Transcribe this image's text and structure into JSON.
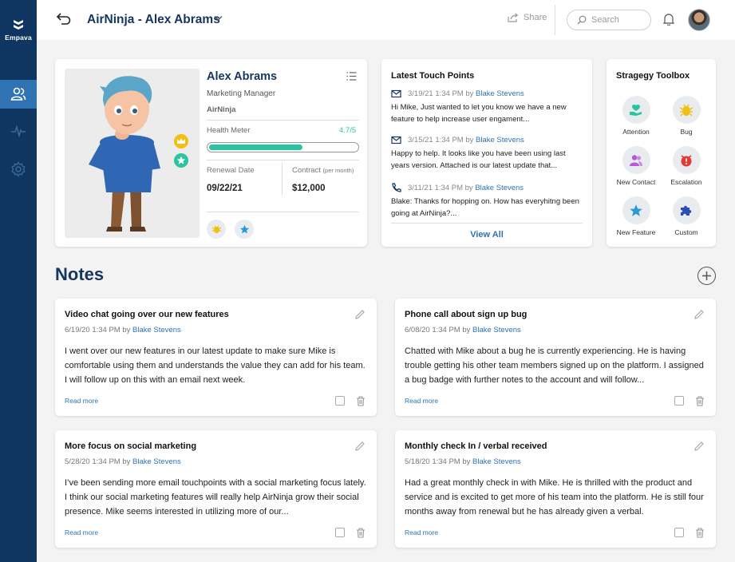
{
  "app": {
    "logo_text": "Empava"
  },
  "header": {
    "title": "AirNinja - Alex Abrams",
    "share_label": "Share",
    "search_placeholder": "Search"
  },
  "profile": {
    "name": "Alex Abrams",
    "title": "Marketing Manager",
    "company": "AirNinja",
    "health_label": "Health Meter",
    "health_value": "4.7/5",
    "health_fraction": 0.63,
    "renewal_label": "Renewal Date",
    "renewal_value": "09/22/21",
    "contract_label": "Contract",
    "contract_sub": "(per month)",
    "contract_value": "$12,000"
  },
  "touch_points": {
    "title": "Latest Touch Points",
    "items": [
      {
        "icon": "mail-icon",
        "date": "3/19/21 1:34 PM by",
        "who": "Blake Stevens",
        "text": "Hi Mike, Just wanted to let you know we have a new feature to help increase user engament..."
      },
      {
        "icon": "mail-icon",
        "date": "3/15/21 1:34 PM by",
        "who": "Blake Stevens",
        "text": "Happy to help. It looks like you have been using last years version. Attached is our latest update that..."
      },
      {
        "icon": "phone-icon",
        "date": "3/11/21 1:34 PM by",
        "who": "Blake Stevens",
        "text": "Blake: Thanks for hopping on. How has everyhitng been going at AirNinja?..."
      }
    ],
    "view_all": "View All"
  },
  "toolbox": {
    "title": "Stragegy Toolbox",
    "tools": [
      {
        "label": "Attention",
        "icon": "attention-icon",
        "color": "#2bc3a0"
      },
      {
        "label": "Bug",
        "icon": "bug-icon",
        "color": "#f2c012"
      },
      {
        "label": "New Contact",
        "icon": "contacts-icon",
        "color": "#b35ad6"
      },
      {
        "label": "Escalation",
        "icon": "escalation-icon",
        "color": "#e53935"
      },
      {
        "label": "New Feature",
        "icon": "star-icon",
        "color": "#2a9ad6"
      },
      {
        "label": "Custom",
        "icon": "puzzle-icon",
        "color": "#2a4fb0"
      }
    ]
  },
  "notes": {
    "title": "Notes",
    "read_more": "Read more",
    "items": [
      {
        "title": "Video chat going over our new features",
        "date": "6/19/20 1:34 PM by",
        "who": "Blake Stevens",
        "body": "I went over our new features in our latest update to make sure Mike is comfortable using them and understands the value they can add for his team. I will follow up on this with an email next week."
      },
      {
        "title": "Phone call about sign up bug",
        "date": "6/08/20 1:34 PM by",
        "who": "Blake Stevens",
        "body": "Chatted with Mike about a bug he is currently experiencing. He is having trouble getting his other team members signed up on the platform. I assigned a bug badge with further notes to the account and will follow..."
      },
      {
        "title": "More focus on social marketing",
        "date": "5/28/20 1:34 PM by",
        "who": "Blake Stevens",
        "body": "I’ve been sending more email touchpoints with a social marketing focus lately. I think our social marketing features will really help AirNinja grow their social presence. Mike seems interested in utilizing more of our..."
      },
      {
        "title": "Monthly check In / verbal received",
        "date": "5/18/20 1:34 PM by",
        "who": "Blake Stevens",
        "body": "Had a great monthly check in with Mike. He is thrilled with the product and service and is excited to get more of his team into the platform. He is still four months away from renewal but he has already given a verbal."
      }
    ]
  }
}
